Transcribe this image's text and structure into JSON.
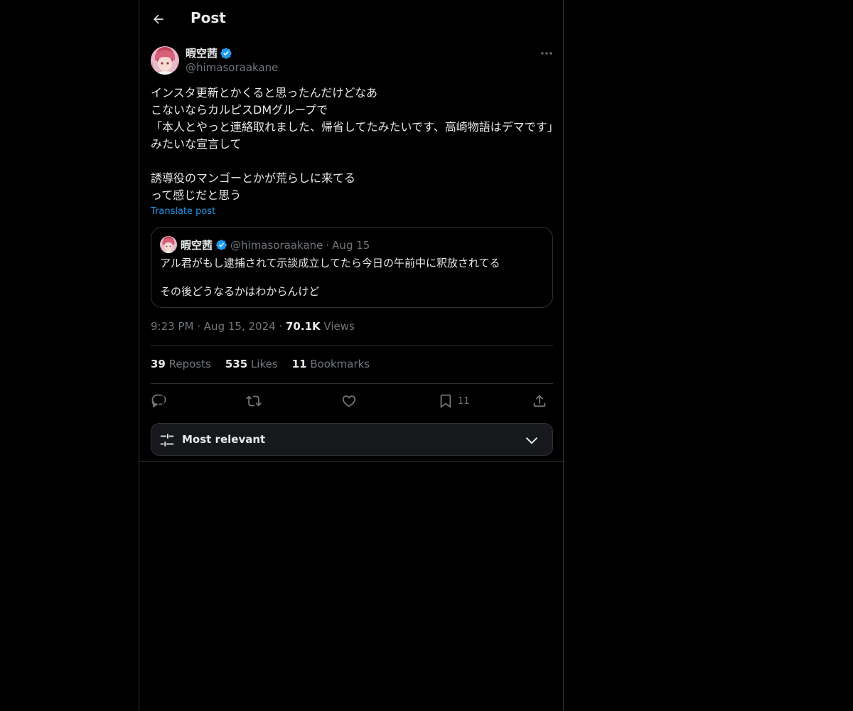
{
  "header": {
    "title": "Post"
  },
  "author": {
    "name": "暇空茜",
    "handle": "@himasoraakane",
    "verified": true
  },
  "post": {
    "text": "インスタ更新とかくると思ったんだけどなあ\nこないならカルピスDMグループで\n「本人とやっと連絡取れました、帰省してたみたいです、高崎物語はデマです」みたいな宣言して\n\n誘導役のマンゴーとかが荒らしに来てる\nって感じだと思う",
    "translate_label": "Translate post"
  },
  "quote": {
    "name": "暇空茜",
    "handle": "@himasoraakane",
    "separator": "·",
    "date": "Aug 15",
    "lines": [
      "アル君がもし逮捕されて示談成立してたら今日の午前中に釈放されてる",
      "その後どうなるかはわからんけど"
    ]
  },
  "meta": {
    "time": "9:23 PM",
    "separator": "·",
    "date": "Aug 15, 2024",
    "views_count": "70.1K",
    "views_label": "Views"
  },
  "stats": {
    "reposts_count": "39",
    "reposts_label": "Reposts",
    "likes_count": "535",
    "likes_label": "Likes",
    "bookmarks_count": "11",
    "bookmarks_label": "Bookmarks"
  },
  "actions": {
    "bookmark_count": "11",
    "icons": [
      "reply-icon",
      "repost-icon",
      "like-icon",
      "bookmark-icon",
      "share-icon"
    ]
  },
  "sort": {
    "label": "Most relevant"
  },
  "colors": {
    "background": "#000000",
    "text": "#e7e9ea",
    "muted": "#71767b",
    "accent": "#1d9bf0",
    "border": "#2f3336"
  }
}
